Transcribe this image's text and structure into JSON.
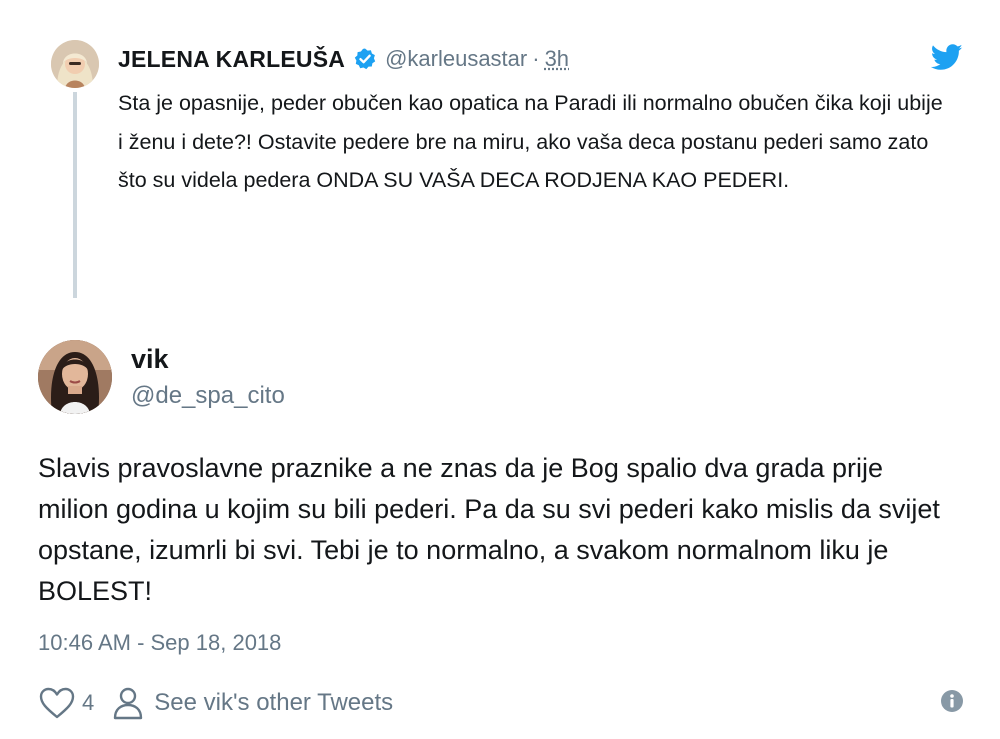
{
  "parent_tweet": {
    "name": "JELENA KARLEUŠA",
    "handle": "@karleusastar",
    "separator": "·",
    "time": "3h",
    "text": "Sta je opasnije, peder obučen kao opatica na Paradi ili normalno obučen čika koji ubije i ženu i dete?! Ostavite pedere bre na miru, ako vaša deca postanu pederi samo zato što su videla pedera ONDA SU VAŠA DECA RODJENA KAO PEDERI.",
    "verified_icon": "verified-badge-icon",
    "brand_icon": "twitter-bird-icon"
  },
  "main_tweet": {
    "name": "vik",
    "handle": "@de_spa_cito",
    "text": "Slavis pravoslavne praznike a ne znas da je Bog spalio dva grada prije milion godina u kojim su bili pederi. Pa da su svi pederi kako mislis da svijet opstane, izumrli bi svi. Tebi je to normalno, a svakom normalnom liku je BOLEST!",
    "timestamp": "10:46 AM - Sep 18, 2018",
    "like_count": "4",
    "other_tweets_label": "See vik's other Tweets"
  },
  "colors": {
    "text": "#14171a",
    "muted": "#657786",
    "brand_blue": "#1da1f2",
    "thread_line": "#ccd6dd"
  }
}
